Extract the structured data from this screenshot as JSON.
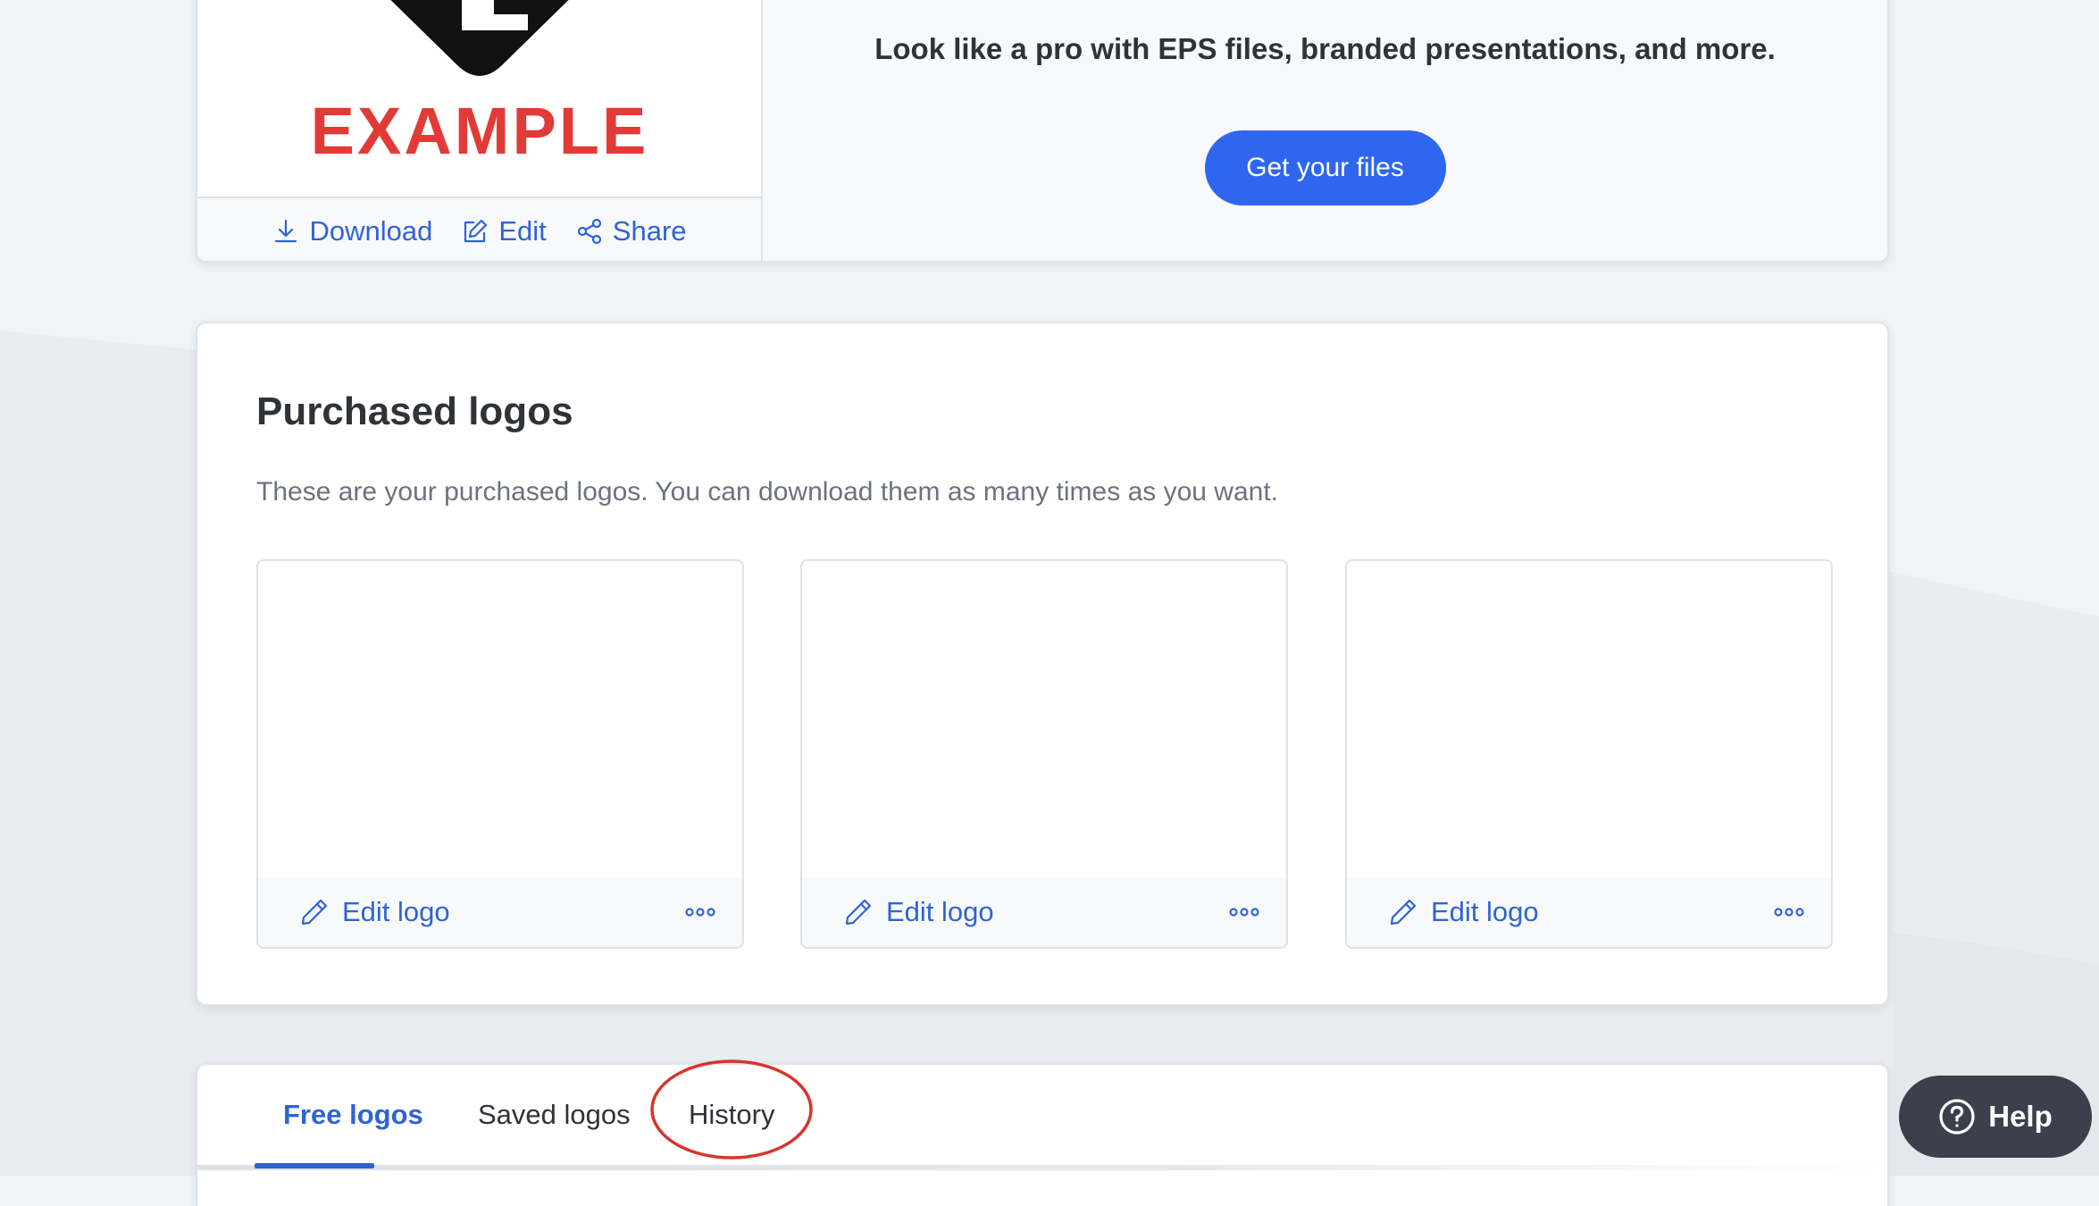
{
  "top_card": {
    "logo_wordmark": "EXAMPLE",
    "logo_initial": "L",
    "actions": {
      "download": "Download",
      "edit": "Edit",
      "share": "Share"
    },
    "promo_text": "Look like a pro with EPS files, branded presentations, and more.",
    "cta_label": "Get your files"
  },
  "purchased": {
    "title": "Purchased logos",
    "description": "These are your purchased logos. You can download them as many times as you want.",
    "tiles": [
      {
        "edit_label": "Edit logo"
      },
      {
        "edit_label": "Edit logo"
      },
      {
        "edit_label": "Edit logo"
      }
    ]
  },
  "tabs": {
    "items": [
      {
        "label": "Free logos",
        "active": true
      },
      {
        "label": "Saved logos",
        "active": false
      },
      {
        "label": "History",
        "active": false
      }
    ]
  },
  "help": {
    "label": "Help"
  },
  "colors": {
    "accent": "#2f63d6",
    "cta": "#2f66f0",
    "logo_red": "#e23a36",
    "annotation": "#d8342c",
    "help_bg": "#3a414c"
  }
}
